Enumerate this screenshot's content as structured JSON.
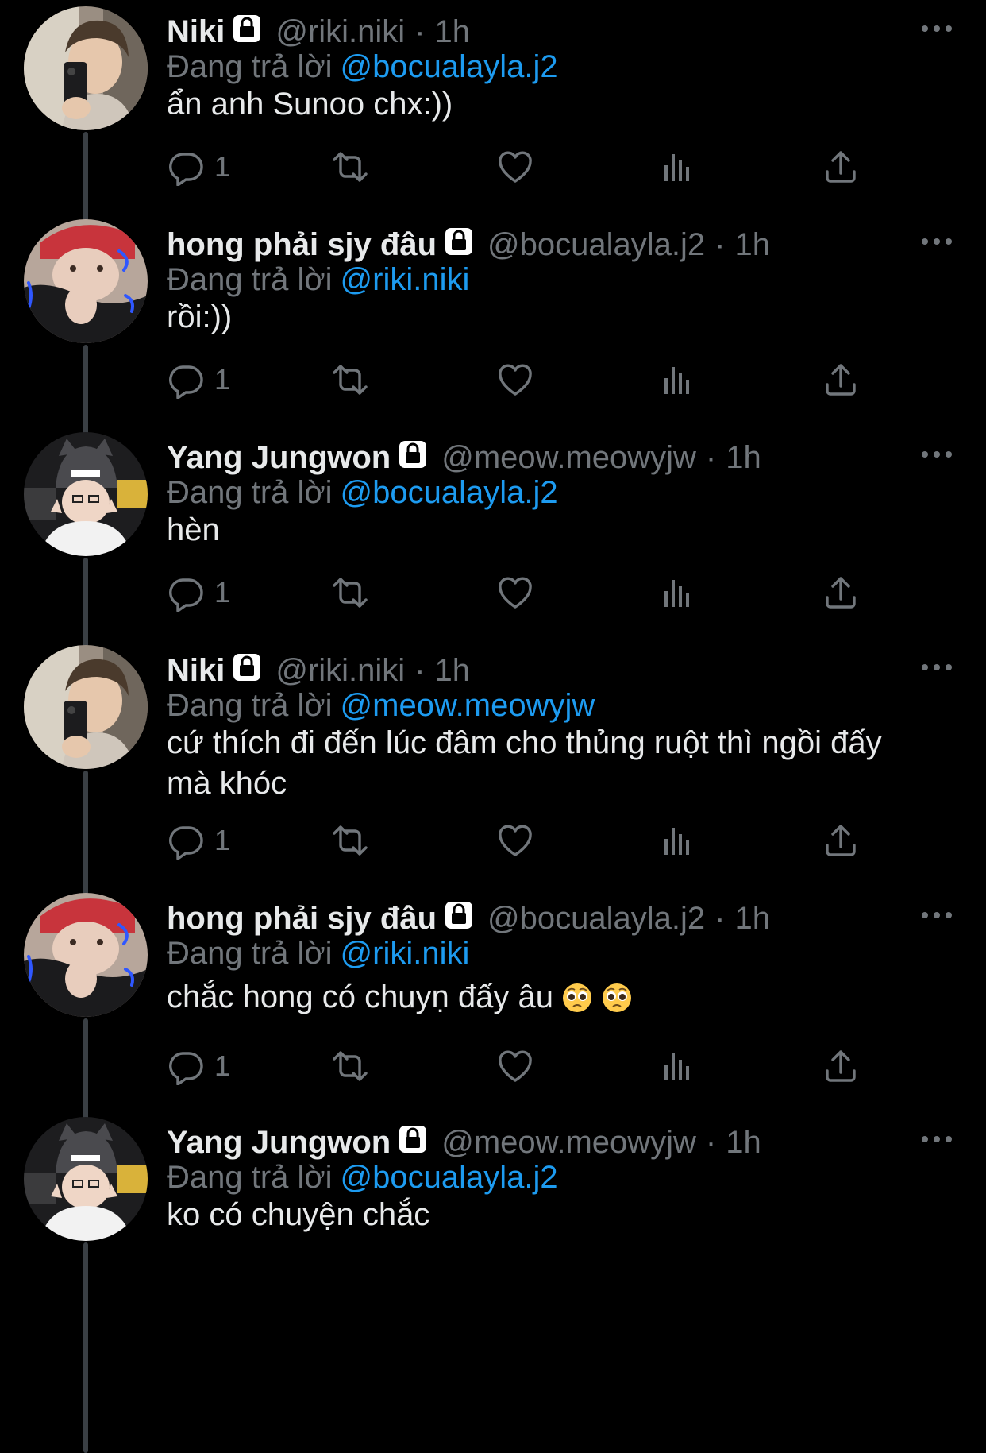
{
  "theme": {
    "background": "#000000",
    "text_primary": "#e7e9ea",
    "text_secondary": "#71767b",
    "link": "#1d9bf0",
    "thread_line": "#3a3f44"
  },
  "reply_prefix": "Đang trả lời",
  "tweets": [
    {
      "avatar": "avatar-niki",
      "name": "Niki",
      "handle": "@riki.niki",
      "separator": "·",
      "time": "1h",
      "locked": true,
      "reply_to": "@bocualayla.j2",
      "text": "ẩn anh Sunoo chx:))",
      "emojis": [],
      "reply_count": "1",
      "actions": [
        "reply-icon",
        "retweet-icon",
        "like-icon",
        "views-icon",
        "share-icon"
      ]
    },
    {
      "avatar": "avatar-bocualayla",
      "name": "hong phải sjy đâu",
      "handle": "@bocualayla.j2",
      "separator": "·",
      "time": "1h",
      "locked": true,
      "reply_to": "@riki.niki",
      "text": "rồi:))",
      "emojis": [],
      "reply_count": "1",
      "actions": [
        "reply-icon",
        "retweet-icon",
        "like-icon",
        "views-icon",
        "share-icon"
      ]
    },
    {
      "avatar": "avatar-jungwon",
      "name": "Yang Jungwon",
      "handle": "@meow.meowyjw",
      "separator": "·",
      "time": "1h",
      "locked": true,
      "reply_to": "@bocualayla.j2",
      "text": "hèn",
      "emojis": [],
      "reply_count": "1",
      "actions": [
        "reply-icon",
        "retweet-icon",
        "like-icon",
        "views-icon",
        "share-icon"
      ]
    },
    {
      "avatar": "avatar-niki",
      "name": "Niki",
      "handle": "@riki.niki",
      "separator": "·",
      "time": "1h",
      "locked": true,
      "reply_to": "@meow.meowyjw",
      "text": "cứ thích đi đến lúc đâm cho thủng ruột thì ngồi đấy mà khóc",
      "emojis": [],
      "reply_count": "1",
      "actions": [
        "reply-icon",
        "retweet-icon",
        "like-icon",
        "views-icon",
        "share-icon"
      ]
    },
    {
      "avatar": "avatar-bocualayla",
      "name": "hong phải sjy đâu",
      "handle": "@bocualayla.j2",
      "separator": "·",
      "time": "1h",
      "locked": true,
      "reply_to": "@riki.niki",
      "text": "chắc hong có chuyṇ đấy âu",
      "emojis": [
        "pleading-face-emoji",
        "pleading-face-emoji"
      ],
      "reply_count": "1",
      "actions": [
        "reply-icon",
        "retweet-icon",
        "like-icon",
        "views-icon",
        "share-icon"
      ]
    },
    {
      "avatar": "avatar-jungwon",
      "name": "Yang Jungwon",
      "handle": "@meow.meowyjw",
      "separator": "·",
      "time": "1h",
      "locked": true,
      "reply_to": "@bocualayla.j2",
      "text": "ko có chuyện chắc",
      "emojis": [],
      "reply_count": null,
      "actions": []
    }
  ]
}
